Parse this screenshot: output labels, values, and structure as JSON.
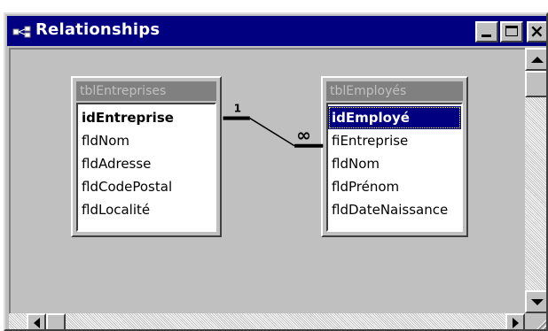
{
  "window": {
    "title": "Relationships"
  },
  "icons": {
    "system": "relationships-window-icon",
    "minimize": "minimize-icon",
    "maximize": "maximize-icon",
    "close": "close-icon",
    "scroll_up": "arrow-up-icon",
    "scroll_down": "arrow-down-icon",
    "scroll_left": "arrow-left-icon",
    "scroll_right": "arrow-right-icon",
    "resize_grip": "resize-grip-icon"
  },
  "close_glyph": "×",
  "tables": [
    {
      "name": "tblEntreprises",
      "fields": [
        "idEntreprise",
        "fldNom",
        "fldAdresse",
        "fldCodePostal",
        "fldLocalité"
      ],
      "primary_key": "idEntreprise"
    },
    {
      "name": "tblEmployés",
      "fields": [
        "idEmployé",
        "fiEntreprise",
        "fldNom",
        "fldPrénom",
        "fldDateNaissance"
      ],
      "primary_key": "idEmployé",
      "selected_field": "idEmployé"
    }
  ],
  "relationship": {
    "one_side": "1",
    "many_side": "∞"
  },
  "colors": {
    "titlebar": "#000080",
    "face": "#c0c0c0",
    "selection": "#000080"
  }
}
